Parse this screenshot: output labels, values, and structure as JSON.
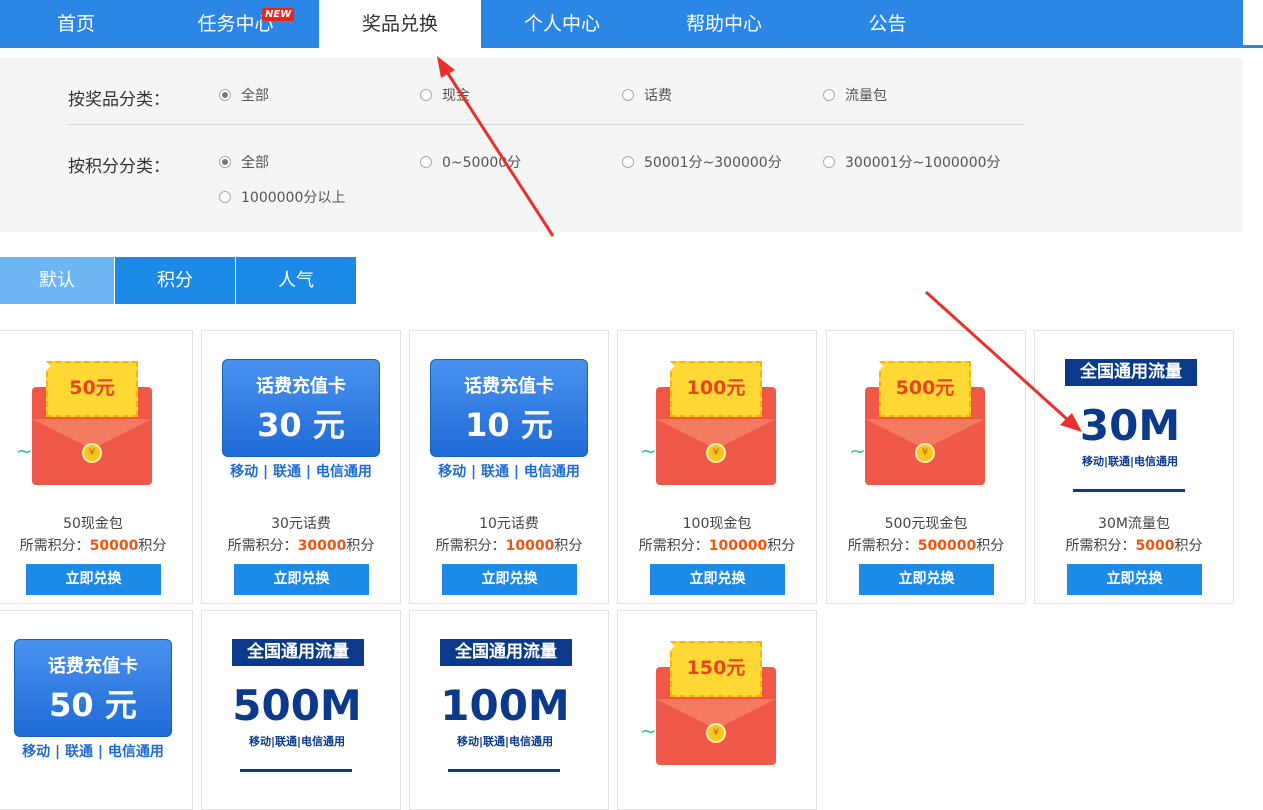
{
  "nav": {
    "items": [
      {
        "label": "首页"
      },
      {
        "label": "任务中心",
        "badge": "NEW"
      },
      {
        "label": "奖品兑换"
      },
      {
        "label": "个人中心"
      },
      {
        "label": "帮助中心"
      },
      {
        "label": "公告"
      }
    ]
  },
  "filters": {
    "category_label": "按奖品分类：",
    "category_options": [
      "全部",
      "现金",
      "话费",
      "流量包"
    ],
    "category_selected": "全部",
    "points_label": "按积分分类：",
    "points_options": [
      "全部",
      "0~50000分",
      "50001分~300000分",
      "300001分~1000000分",
      "1000000分以上"
    ],
    "points_selected": "全部"
  },
  "sort_tabs": [
    {
      "label": "默认"
    },
    {
      "label": "积分"
    },
    {
      "label": "人气"
    }
  ],
  "sort_selected": "默认",
  "points_prefix": "所需积分：",
  "points_suffix": "积分",
  "button_label": "立即兑换",
  "products": [
    {
      "name": "50现金包",
      "points": "50000",
      "image": {
        "type": "envelope",
        "amount": "50元"
      }
    },
    {
      "name": "30元话费",
      "points": "30000",
      "image": {
        "type": "phonecard",
        "title": "话费充值卡",
        "value": "30 元",
        "sub": "移动 | 联通 | 电信通用"
      }
    },
    {
      "name": "10元话费",
      "points": "10000",
      "image": {
        "type": "phonecard",
        "title": "话费充值卡",
        "value": "10 元",
        "sub": "移动 | 联通 | 电信通用"
      }
    },
    {
      "name": "100现金包",
      "points": "100000",
      "image": {
        "type": "envelope",
        "amount": "100元"
      }
    },
    {
      "name": "500元现金包",
      "points": "500000",
      "image": {
        "type": "envelope",
        "amount": "500元"
      }
    },
    {
      "name": "30M流量包",
      "points": "5000",
      "image": {
        "type": "data",
        "header": "全国通用流量",
        "size": "30M",
        "sub": "移动|联通|电信通用"
      }
    },
    {
      "name": "",
      "points": "",
      "image": {
        "type": "phonecard",
        "title": "话费充值卡",
        "value": "50 元",
        "sub": "移动 | 联通 | 电信通用"
      }
    },
    {
      "name": "",
      "points": "",
      "image": {
        "type": "data",
        "header": "全国通用流量",
        "size": "500M",
        "sub": "移动|联通|电信通用"
      }
    },
    {
      "name": "",
      "points": "",
      "image": {
        "type": "data",
        "header": "全国通用流量",
        "size": "100M",
        "sub": "移动|联通|电信通用"
      }
    },
    {
      "name": "",
      "points": "",
      "image": {
        "type": "envelope",
        "amount": "150元"
      }
    }
  ],
  "colors": {
    "nav": "#2b86e6",
    "button": "#1e8ae8",
    "sort_active": "#6eb6f3",
    "points": "#f0540f",
    "arrow": "#e8302c"
  }
}
